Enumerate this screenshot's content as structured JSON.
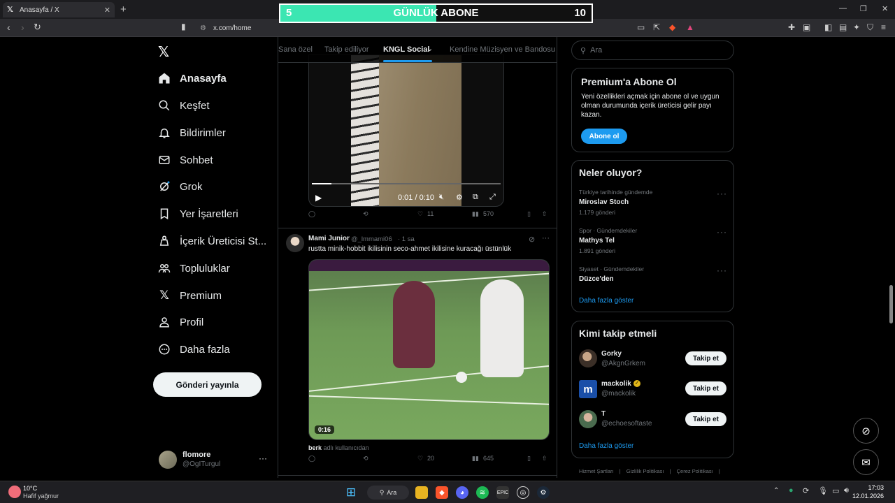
{
  "browser": {
    "tab_title": "Anasayfa / X",
    "url": "x.com/home"
  },
  "banner": {
    "left_value": "5",
    "title": "GÜNLÜK ABONE",
    "right_value": "10",
    "progress_fraction": 0.5,
    "fill_color": "#3be6b2"
  },
  "nav": {
    "items": [
      {
        "label": "Anasayfa",
        "icon": "home-icon"
      },
      {
        "label": "Keşfet",
        "icon": "search-icon"
      },
      {
        "label": "Bildirimler",
        "icon": "bell-icon"
      },
      {
        "label": "Sohbet",
        "icon": "mail-icon"
      },
      {
        "label": "Grok",
        "icon": "grok-icon"
      },
      {
        "label": "Yer İşaretleri",
        "icon": "bookmark-icon"
      },
      {
        "label": "İçerik Üreticisi St...",
        "icon": "creator-studio-icon"
      },
      {
        "label": "Topluluklar",
        "icon": "communities-icon"
      },
      {
        "label": "Premium",
        "icon": "x-icon"
      },
      {
        "label": "Profil",
        "icon": "user-icon"
      },
      {
        "label": "Daha fazla",
        "icon": "more-circle-icon"
      }
    ],
    "post_button": "Gönderi yayınla",
    "account": {
      "name": "flomore",
      "handle": "@OgITurgul"
    }
  },
  "feed": {
    "tabs": [
      "Sana özel",
      "Takip ediliyor",
      "KNGL Social",
      "Kendine Müzisyen ve Bandosu"
    ],
    "post1": {
      "video_time": "0:01 / 0:10",
      "likes": "11",
      "views": "570"
    },
    "post2": {
      "author": "Mami Junior",
      "handle": "@_lmmami06",
      "time": "· 1 sa",
      "text": "rustta minik-hobbit ikilisinin seco-ahmet ikilisine kuracağı üstünlük",
      "duration": "0:16",
      "credit_user": "berk",
      "credit_suffix": "adlı kullanıcıdan",
      "likes": "20",
      "views": "645"
    }
  },
  "sidebar": {
    "search_placeholder": "Ara",
    "premium": {
      "title": "Premium'a Abone Ol",
      "text": "Yeni özellikleri açmak için abone ol ve uygun olman durumunda içerik üreticisi gelir payı kazan.",
      "button": "Abone ol"
    },
    "trends": {
      "title": "Neler oluyor?",
      "items": [
        {
          "meta": "Türkiye tarihinde gündemde",
          "name": "Miroslav Stoch",
          "count": "1.179 gönderi"
        },
        {
          "meta": "Spor · Gündemdekiler",
          "name": "Mathys Tel",
          "count": "1.891 gönderi"
        },
        {
          "meta": "Siyaset · Gündemdekiler",
          "name": "Düzce'den",
          "count": ""
        }
      ],
      "more": "Daha fazla göster"
    },
    "who_to_follow": {
      "title": "Kimi takip etmeli",
      "items": [
        {
          "name": "Gorky",
          "handle": "@AkgnGrkem",
          "button": "Takip et"
        },
        {
          "name": "mackolik",
          "handle": "@mackolik",
          "button": "Takip et"
        },
        {
          "name": "T",
          "handle": "@echoesoftaste",
          "button": "Takip et"
        }
      ],
      "more": "Daha fazla göster"
    },
    "footer": [
      "Hizmet Şartları",
      "Gizlilik Politikası",
      "Çerez Politikası"
    ]
  },
  "taskbar": {
    "weather_temp": "10°C",
    "weather_desc": "Hafif yağmur",
    "search_label": "Ara",
    "time": "17:03",
    "date": "12.01.2026"
  },
  "colors": {
    "accent": "#1d9bf0",
    "border": "#2f3336",
    "muted": "#71767b"
  }
}
